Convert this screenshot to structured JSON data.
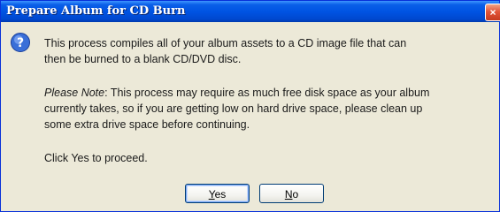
{
  "dialog": {
    "title": "Prepare Album for CD Burn",
    "close_glyph": "×",
    "icon": "question-icon",
    "message_line1": "This process compiles all of your album assets to a CD image file that can",
    "message_line2": "then be burned to a blank CD/DVD disc.",
    "note_label": "Please Note",
    "note_line1_rest": ": This process may require as much free disk space as your album",
    "note_line2": "currently takes, so if you are getting low on hard drive space, please clean up",
    "note_line3": "some extra drive space before continuing.",
    "prompt": "Click Yes to proceed.",
    "yes_mnemonic": "Y",
    "yes_rest": "es",
    "no_mnemonic": "N",
    "no_rest": "o"
  },
  "colors": {
    "titlebar": "#0054e3",
    "window_bg": "#ece9d8",
    "close_button": "#e2553a"
  }
}
